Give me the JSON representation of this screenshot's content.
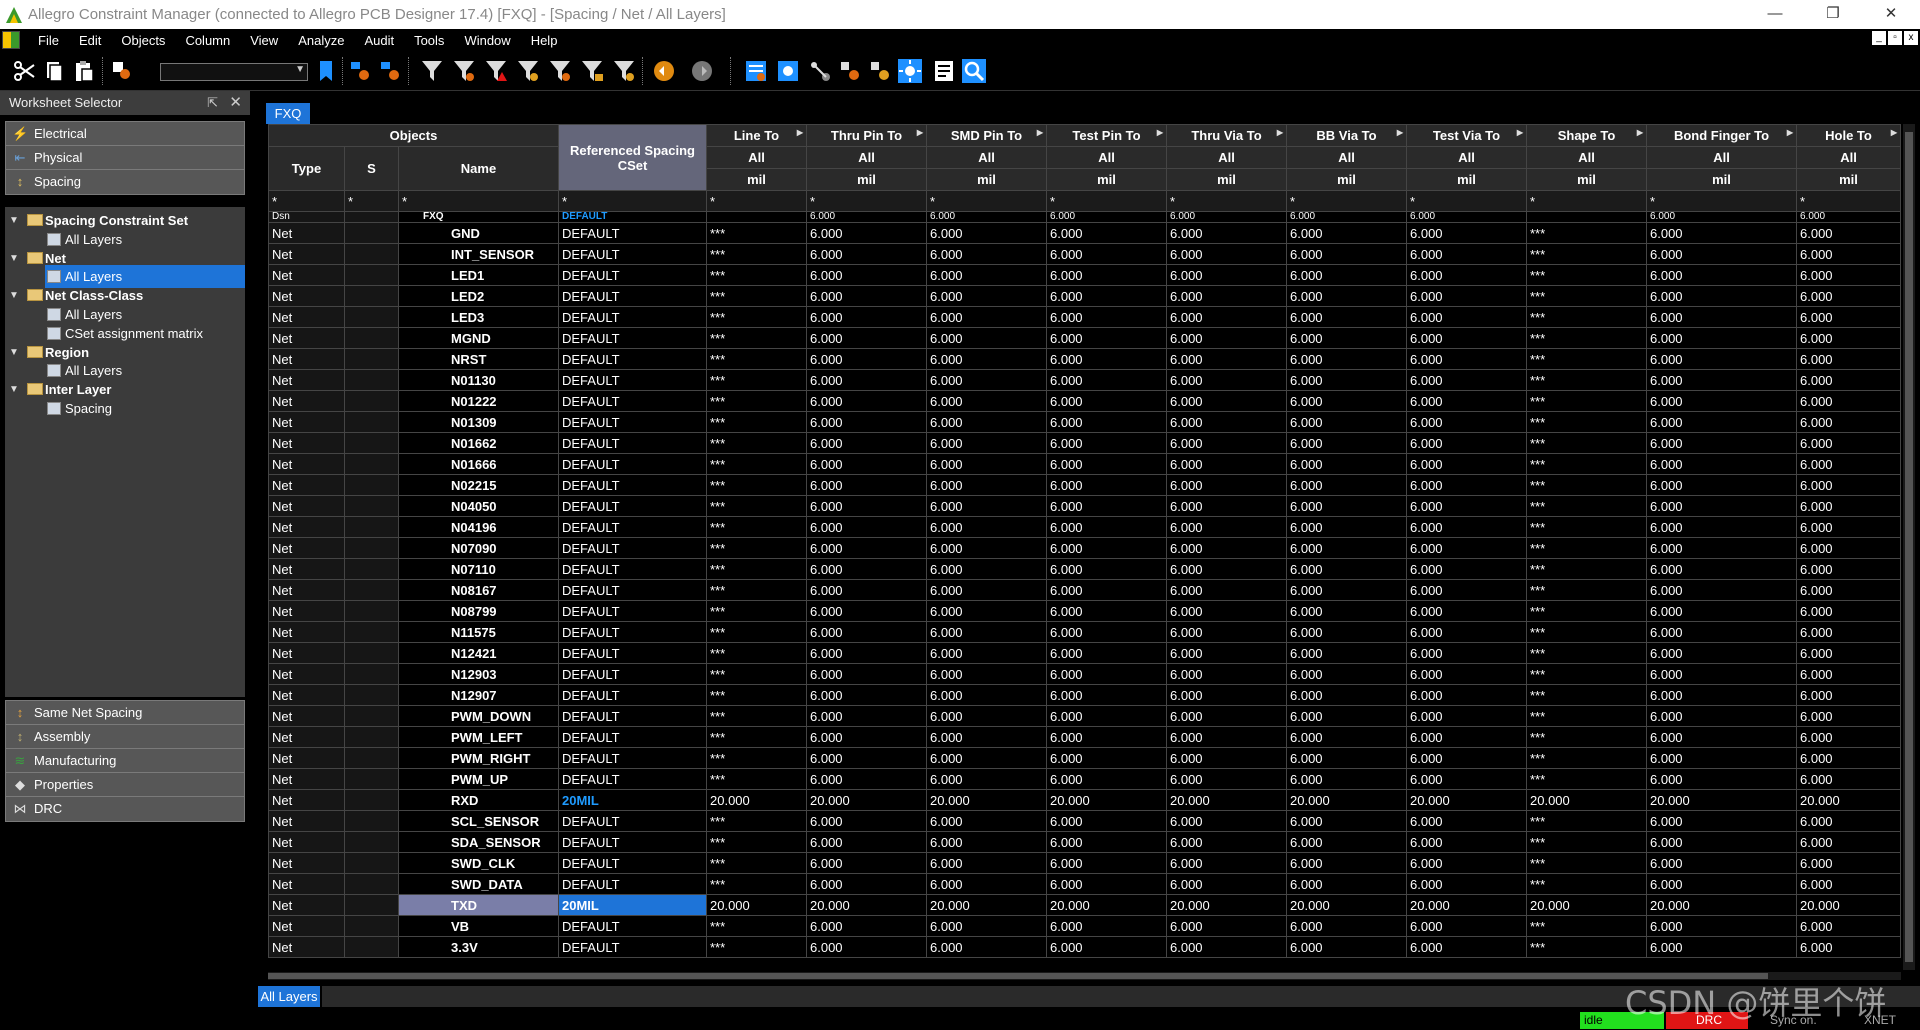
{
  "window": {
    "title": "Allegro Constraint Manager (connected to Allegro PCB Designer 17.4) [FXQ] - [Spacing / Net / All Layers]",
    "min": "—",
    "max": "❐",
    "close": "✕"
  },
  "menu": [
    "File",
    "Edit",
    "Objects",
    "Column",
    "View",
    "Analyze",
    "Audit",
    "Tools",
    "Window",
    "Help"
  ],
  "worksheet_selector": {
    "title": "Worksheet Selector",
    "pin": "⇱",
    "close": "✕",
    "top_buttons": [
      {
        "label": "Electrical",
        "icon": "electrical-icon",
        "color": "#d84a1b"
      },
      {
        "label": "Physical",
        "icon": "physical-icon",
        "color": "#6aa0d8"
      },
      {
        "label": "Spacing",
        "icon": "spacing-icon",
        "color": "#e0c060"
      }
    ],
    "tree": [
      {
        "label": "Spacing Constraint Set",
        "kind": "folder",
        "level": 0,
        "expanded": true
      },
      {
        "label": "All Layers",
        "kind": "sheet",
        "level": 1
      },
      {
        "label": "Net",
        "kind": "folder",
        "level": 0,
        "expanded": true
      },
      {
        "label": "All Layers",
        "kind": "sheet",
        "level": 1,
        "selected": true
      },
      {
        "label": "Net Class-Class",
        "kind": "folder",
        "level": 0,
        "expanded": true
      },
      {
        "label": "All Layers",
        "kind": "sheet",
        "level": 1
      },
      {
        "label": "CSet assignment matrix",
        "kind": "sheet",
        "level": 1
      },
      {
        "label": "Region",
        "kind": "folder",
        "level": 0,
        "expanded": true
      },
      {
        "label": "All Layers",
        "kind": "sheet",
        "level": 1
      },
      {
        "label": "Inter Layer",
        "kind": "folder",
        "level": 0,
        "expanded": true
      },
      {
        "label": "Spacing",
        "kind": "sheet",
        "level": 1
      }
    ],
    "bottom_buttons": [
      {
        "label": "Same Net Spacing",
        "icon": "same-net-spacing-icon",
        "color": "#e0a040"
      },
      {
        "label": "Assembly",
        "icon": "assembly-icon",
        "color": "#c0b070"
      },
      {
        "label": "Manufacturing",
        "icon": "manufacturing-icon",
        "color": "#3aa040"
      },
      {
        "label": "Properties",
        "icon": "properties-icon",
        "color": "#ddd"
      },
      {
        "label": "DRC",
        "icon": "drc-icon",
        "color": "#ddd"
      }
    ]
  },
  "design_tab": "FXQ",
  "bottom_tab": "All Layers",
  "grid": {
    "objects_header": "Objects",
    "type_header": "Type",
    "s_header": "S",
    "name_header": "Name",
    "ref_header": "Referenced Spacing CSet",
    "columns": [
      "Line To",
      "Thru Pin To",
      "SMD Pin To",
      "Test Pin To",
      "Thru Via To",
      "BB Via To",
      "Test Via To",
      "Shape To",
      "Bond Finger To",
      "Hole To"
    ],
    "layer_label": "All",
    "unit_label": "mil",
    "filter": "*",
    "partial_row": {
      "type": "Dsn",
      "name": "FXQ",
      "ref": "DEFAULT",
      "vals": [
        "",
        "6.000",
        "6.000",
        "6.000",
        "6.000",
        "6.000",
        "6.000",
        "",
        "6.000",
        "6.000"
      ]
    },
    "rows": [
      {
        "type": "Net",
        "name": "GND",
        "ref": "DEFAULT",
        "vals": [
          "***",
          "6.000",
          "6.000",
          "6.000",
          "6.000",
          "6.000",
          "6.000",
          "***",
          "6.000",
          "6.000"
        ]
      },
      {
        "type": "Net",
        "name": "INT_SENSOR",
        "ref": "DEFAULT",
        "vals": [
          "***",
          "6.000",
          "6.000",
          "6.000",
          "6.000",
          "6.000",
          "6.000",
          "***",
          "6.000",
          "6.000"
        ]
      },
      {
        "type": "Net",
        "name": "LED1",
        "ref": "DEFAULT",
        "vals": [
          "***",
          "6.000",
          "6.000",
          "6.000",
          "6.000",
          "6.000",
          "6.000",
          "***",
          "6.000",
          "6.000"
        ]
      },
      {
        "type": "Net",
        "name": "LED2",
        "ref": "DEFAULT",
        "vals": [
          "***",
          "6.000",
          "6.000",
          "6.000",
          "6.000",
          "6.000",
          "6.000",
          "***",
          "6.000",
          "6.000"
        ]
      },
      {
        "type": "Net",
        "name": "LED3",
        "ref": "DEFAULT",
        "vals": [
          "***",
          "6.000",
          "6.000",
          "6.000",
          "6.000",
          "6.000",
          "6.000",
          "***",
          "6.000",
          "6.000"
        ]
      },
      {
        "type": "Net",
        "name": "MGND",
        "ref": "DEFAULT",
        "vals": [
          "***",
          "6.000",
          "6.000",
          "6.000",
          "6.000",
          "6.000",
          "6.000",
          "***",
          "6.000",
          "6.000"
        ]
      },
      {
        "type": "Net",
        "name": "NRST",
        "ref": "DEFAULT",
        "vals": [
          "***",
          "6.000",
          "6.000",
          "6.000",
          "6.000",
          "6.000",
          "6.000",
          "***",
          "6.000",
          "6.000"
        ]
      },
      {
        "type": "Net",
        "name": "N01130",
        "ref": "DEFAULT",
        "vals": [
          "***",
          "6.000",
          "6.000",
          "6.000",
          "6.000",
          "6.000",
          "6.000",
          "***",
          "6.000",
          "6.000"
        ]
      },
      {
        "type": "Net",
        "name": "N01222",
        "ref": "DEFAULT",
        "vals": [
          "***",
          "6.000",
          "6.000",
          "6.000",
          "6.000",
          "6.000",
          "6.000",
          "***",
          "6.000",
          "6.000"
        ]
      },
      {
        "type": "Net",
        "name": "N01309",
        "ref": "DEFAULT",
        "vals": [
          "***",
          "6.000",
          "6.000",
          "6.000",
          "6.000",
          "6.000",
          "6.000",
          "***",
          "6.000",
          "6.000"
        ]
      },
      {
        "type": "Net",
        "name": "N01662",
        "ref": "DEFAULT",
        "vals": [
          "***",
          "6.000",
          "6.000",
          "6.000",
          "6.000",
          "6.000",
          "6.000",
          "***",
          "6.000",
          "6.000"
        ]
      },
      {
        "type": "Net",
        "name": "N01666",
        "ref": "DEFAULT",
        "vals": [
          "***",
          "6.000",
          "6.000",
          "6.000",
          "6.000",
          "6.000",
          "6.000",
          "***",
          "6.000",
          "6.000"
        ]
      },
      {
        "type": "Net",
        "name": "N02215",
        "ref": "DEFAULT",
        "vals": [
          "***",
          "6.000",
          "6.000",
          "6.000",
          "6.000",
          "6.000",
          "6.000",
          "***",
          "6.000",
          "6.000"
        ]
      },
      {
        "type": "Net",
        "name": "N04050",
        "ref": "DEFAULT",
        "vals": [
          "***",
          "6.000",
          "6.000",
          "6.000",
          "6.000",
          "6.000",
          "6.000",
          "***",
          "6.000",
          "6.000"
        ]
      },
      {
        "type": "Net",
        "name": "N04196",
        "ref": "DEFAULT",
        "vals": [
          "***",
          "6.000",
          "6.000",
          "6.000",
          "6.000",
          "6.000",
          "6.000",
          "***",
          "6.000",
          "6.000"
        ]
      },
      {
        "type": "Net",
        "name": "N07090",
        "ref": "DEFAULT",
        "vals": [
          "***",
          "6.000",
          "6.000",
          "6.000",
          "6.000",
          "6.000",
          "6.000",
          "***",
          "6.000",
          "6.000"
        ]
      },
      {
        "type": "Net",
        "name": "N07110",
        "ref": "DEFAULT",
        "vals": [
          "***",
          "6.000",
          "6.000",
          "6.000",
          "6.000",
          "6.000",
          "6.000",
          "***",
          "6.000",
          "6.000"
        ]
      },
      {
        "type": "Net",
        "name": "N08167",
        "ref": "DEFAULT",
        "vals": [
          "***",
          "6.000",
          "6.000",
          "6.000",
          "6.000",
          "6.000",
          "6.000",
          "***",
          "6.000",
          "6.000"
        ]
      },
      {
        "type": "Net",
        "name": "N08799",
        "ref": "DEFAULT",
        "vals": [
          "***",
          "6.000",
          "6.000",
          "6.000",
          "6.000",
          "6.000",
          "6.000",
          "***",
          "6.000",
          "6.000"
        ]
      },
      {
        "type": "Net",
        "name": "N11575",
        "ref": "DEFAULT",
        "vals": [
          "***",
          "6.000",
          "6.000",
          "6.000",
          "6.000",
          "6.000",
          "6.000",
          "***",
          "6.000",
          "6.000"
        ]
      },
      {
        "type": "Net",
        "name": "N12421",
        "ref": "DEFAULT",
        "vals": [
          "***",
          "6.000",
          "6.000",
          "6.000",
          "6.000",
          "6.000",
          "6.000",
          "***",
          "6.000",
          "6.000"
        ]
      },
      {
        "type": "Net",
        "name": "N12903",
        "ref": "DEFAULT",
        "vals": [
          "***",
          "6.000",
          "6.000",
          "6.000",
          "6.000",
          "6.000",
          "6.000",
          "***",
          "6.000",
          "6.000"
        ]
      },
      {
        "type": "Net",
        "name": "N12907",
        "ref": "DEFAULT",
        "vals": [
          "***",
          "6.000",
          "6.000",
          "6.000",
          "6.000",
          "6.000",
          "6.000",
          "***",
          "6.000",
          "6.000"
        ]
      },
      {
        "type": "Net",
        "name": "PWM_DOWN",
        "ref": "DEFAULT",
        "vals": [
          "***",
          "6.000",
          "6.000",
          "6.000",
          "6.000",
          "6.000",
          "6.000",
          "***",
          "6.000",
          "6.000"
        ]
      },
      {
        "type": "Net",
        "name": "PWM_LEFT",
        "ref": "DEFAULT",
        "vals": [
          "***",
          "6.000",
          "6.000",
          "6.000",
          "6.000",
          "6.000",
          "6.000",
          "***",
          "6.000",
          "6.000"
        ]
      },
      {
        "type": "Net",
        "name": "PWM_RIGHT",
        "ref": "DEFAULT",
        "vals": [
          "***",
          "6.000",
          "6.000",
          "6.000",
          "6.000",
          "6.000",
          "6.000",
          "***",
          "6.000",
          "6.000"
        ]
      },
      {
        "type": "Net",
        "name": "PWM_UP",
        "ref": "DEFAULT",
        "vals": [
          "***",
          "6.000",
          "6.000",
          "6.000",
          "6.000",
          "6.000",
          "6.000",
          "***",
          "6.000",
          "6.000"
        ]
      },
      {
        "type": "Net",
        "name": "RXD",
        "ref": "20MIL",
        "refBlue": true,
        "vals": [
          "20.000",
          "20.000",
          "20.000",
          "20.000",
          "20.000",
          "20.000",
          "20.000",
          "20.000",
          "20.000",
          "20.000"
        ]
      },
      {
        "type": "Net",
        "name": "SCL_SENSOR",
        "ref": "DEFAULT",
        "vals": [
          "***",
          "6.000",
          "6.000",
          "6.000",
          "6.000",
          "6.000",
          "6.000",
          "***",
          "6.000",
          "6.000"
        ]
      },
      {
        "type": "Net",
        "name": "SDA_SENSOR",
        "ref": "DEFAULT",
        "vals": [
          "***",
          "6.000",
          "6.000",
          "6.000",
          "6.000",
          "6.000",
          "6.000",
          "***",
          "6.000",
          "6.000"
        ]
      },
      {
        "type": "Net",
        "name": "SWD_CLK",
        "ref": "DEFAULT",
        "vals": [
          "***",
          "6.000",
          "6.000",
          "6.000",
          "6.000",
          "6.000",
          "6.000",
          "***",
          "6.000",
          "6.000"
        ]
      },
      {
        "type": "Net",
        "name": "SWD_DATA",
        "ref": "DEFAULT",
        "vals": [
          "***",
          "6.000",
          "6.000",
          "6.000",
          "6.000",
          "6.000",
          "6.000",
          "***",
          "6.000",
          "6.000"
        ]
      },
      {
        "type": "Net",
        "name": "TXD",
        "ref": "20MIL",
        "selected": true,
        "vals": [
          "20.000",
          "20.000",
          "20.000",
          "20.000",
          "20.000",
          "20.000",
          "20.000",
          "20.000",
          "20.000",
          "20.000"
        ]
      },
      {
        "type": "Net",
        "name": "VB",
        "ref": "DEFAULT",
        "vals": [
          "***",
          "6.000",
          "6.000",
          "6.000",
          "6.000",
          "6.000",
          "6.000",
          "***",
          "6.000",
          "6.000"
        ]
      },
      {
        "type": "Net",
        "name": "3.3V",
        "ref": "DEFAULT",
        "vals": [
          "***",
          "6.000",
          "6.000",
          "6.000",
          "6.000",
          "6.000",
          "6.000",
          "***",
          "6.000",
          "6.000"
        ]
      }
    ]
  },
  "status": {
    "idle": "idle",
    "idle_color": "#22e01e",
    "drc": "DRC",
    "drc_color": "#e01515",
    "sync": "Sync on.",
    "xnet": "XNET"
  },
  "watermark": "CSDN @饼里个饼"
}
